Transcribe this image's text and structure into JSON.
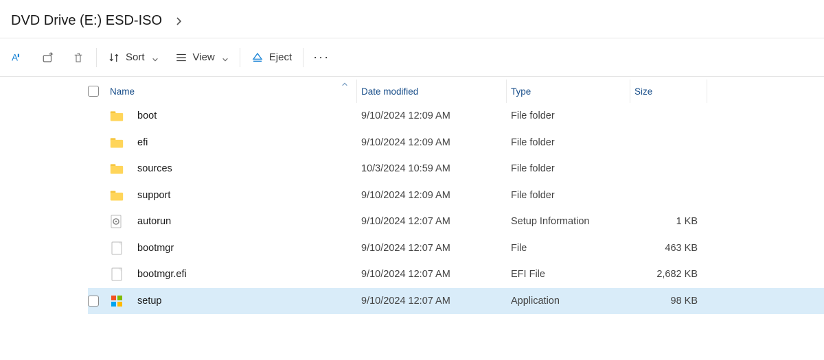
{
  "breadcrumb": {
    "title": "DVD Drive (E:) ESD-ISO"
  },
  "toolbar": {
    "sort_label": "Sort",
    "view_label": "View",
    "eject_label": "Eject"
  },
  "columns": {
    "name": "Name",
    "date": "Date modified",
    "type": "Type",
    "size": "Size"
  },
  "files": [
    {
      "icon": "folder",
      "name": "boot",
      "date": "9/10/2024 12:09 AM",
      "type": "File folder",
      "size": "",
      "selected": false
    },
    {
      "icon": "folder",
      "name": "efi",
      "date": "9/10/2024 12:09 AM",
      "type": "File folder",
      "size": "",
      "selected": false
    },
    {
      "icon": "folder",
      "name": "sources",
      "date": "10/3/2024 10:59 AM",
      "type": "File folder",
      "size": "",
      "selected": false
    },
    {
      "icon": "folder",
      "name": "support",
      "date": "9/10/2024 12:09 AM",
      "type": "File folder",
      "size": "",
      "selected": false
    },
    {
      "icon": "settings",
      "name": "autorun",
      "date": "9/10/2024 12:07 AM",
      "type": "Setup Information",
      "size": "1 KB",
      "selected": false
    },
    {
      "icon": "file",
      "name": "bootmgr",
      "date": "9/10/2024 12:07 AM",
      "type": "File",
      "size": "463 KB",
      "selected": false
    },
    {
      "icon": "file",
      "name": "bootmgr.efi",
      "date": "9/10/2024 12:07 AM",
      "type": "EFI File",
      "size": "2,682 KB",
      "selected": false
    },
    {
      "icon": "app",
      "name": "setup",
      "date": "9/10/2024 12:07 AM",
      "type": "Application",
      "size": "98 KB",
      "selected": true
    }
  ]
}
